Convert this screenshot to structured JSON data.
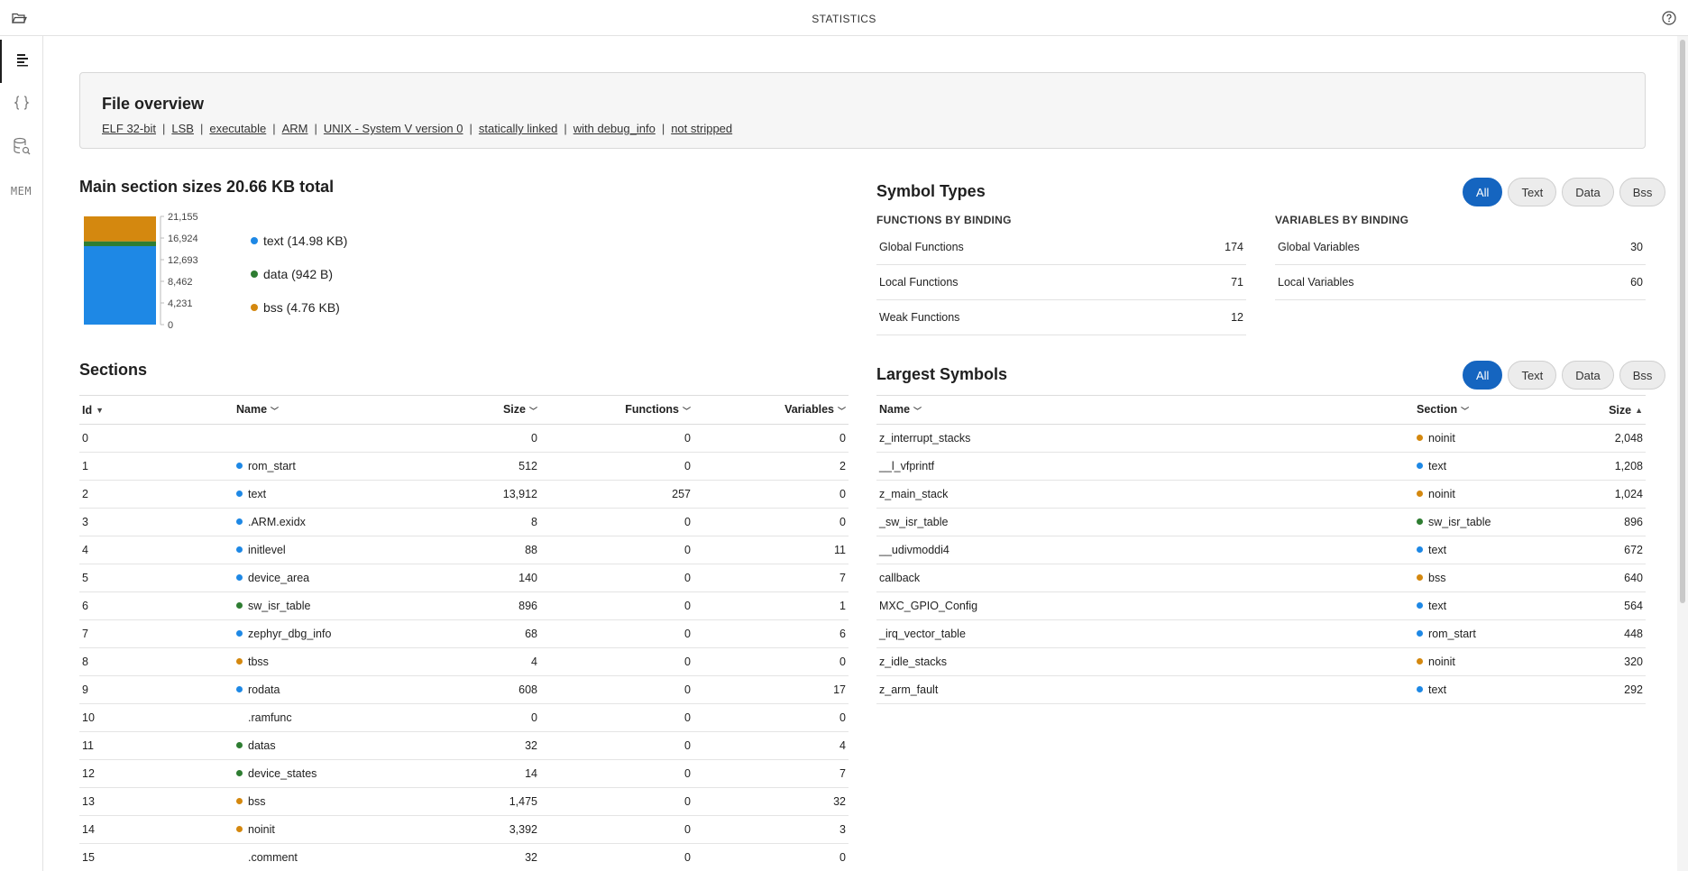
{
  "app": {
    "title": "STATISTICS"
  },
  "overview": {
    "title": "File overview",
    "properties": [
      "ELF 32-bit",
      "LSB",
      "executable",
      "ARM",
      "UNIX - System V version 0",
      "statically linked",
      "with debug_info",
      "not stripped"
    ]
  },
  "sizes": {
    "title": "Main section sizes 20.66 KB total",
    "legend": [
      {
        "label": "text (14.98 KB)",
        "color": "#1e88e5"
      },
      {
        "label": "data (942 B)",
        "color": "#2e7d32"
      },
      {
        "label": "bss (4.76 KB)",
        "color": "#d4880f"
      }
    ]
  },
  "chart_data": {
    "type": "bar",
    "stacked": true,
    "categories": [
      ""
    ],
    "series": [
      {
        "name": "text",
        "values": [
          15340
        ],
        "color": "#1e88e5"
      },
      {
        "name": "data",
        "values": [
          942
        ],
        "color": "#2e7d32"
      },
      {
        "name": "bss",
        "values": [
          4873
        ],
        "color": "#d4880f"
      }
    ],
    "yticks": [
      "21,155",
      "16,924",
      "12,693",
      "8,462",
      "4,231",
      "0"
    ],
    "ylim": [
      0,
      21155
    ]
  },
  "symbol_types": {
    "title": "Symbol Types",
    "filters": [
      "All",
      "Text",
      "Data",
      "Bss"
    ],
    "active_filter": "All",
    "functions": {
      "title": "FUNCTIONS BY BINDING",
      "rows": [
        {
          "label": "Global Functions",
          "value": "174"
        },
        {
          "label": "Local Functions",
          "value": "71"
        },
        {
          "label": "Weak Functions",
          "value": "12"
        }
      ]
    },
    "variables": {
      "title": "VARIABLES BY BINDING",
      "rows": [
        {
          "label": "Global Variables",
          "value": "30"
        },
        {
          "label": "Local Variables",
          "value": "60"
        }
      ]
    }
  },
  "sections": {
    "title": "Sections",
    "columns": [
      "Id",
      "Name",
      "Size",
      "Functions",
      "Variables"
    ],
    "rows": [
      {
        "id": "0",
        "name": "",
        "color": "",
        "size": "0",
        "functions": "0",
        "variables": "0"
      },
      {
        "id": "1",
        "name": "rom_start",
        "color": "#1e88e5",
        "size": "512",
        "functions": "0",
        "variables": "2"
      },
      {
        "id": "2",
        "name": "text",
        "color": "#1e88e5",
        "size": "13,912",
        "functions": "257",
        "variables": "0"
      },
      {
        "id": "3",
        "name": ".ARM.exidx",
        "color": "#1e88e5",
        "size": "8",
        "functions": "0",
        "variables": "0"
      },
      {
        "id": "4",
        "name": "initlevel",
        "color": "#1e88e5",
        "size": "88",
        "functions": "0",
        "variables": "11"
      },
      {
        "id": "5",
        "name": "device_area",
        "color": "#1e88e5",
        "size": "140",
        "functions": "0",
        "variables": "7"
      },
      {
        "id": "6",
        "name": "sw_isr_table",
        "color": "#2e7d32",
        "size": "896",
        "functions": "0",
        "variables": "1"
      },
      {
        "id": "7",
        "name": "zephyr_dbg_info",
        "color": "#1e88e5",
        "size": "68",
        "functions": "0",
        "variables": "6"
      },
      {
        "id": "8",
        "name": "tbss",
        "color": "#d4880f",
        "size": "4",
        "functions": "0",
        "variables": "0"
      },
      {
        "id": "9",
        "name": "rodata",
        "color": "#1e88e5",
        "size": "608",
        "functions": "0",
        "variables": "17"
      },
      {
        "id": "10",
        "name": ".ramfunc",
        "color": "",
        "size": "0",
        "functions": "0",
        "variables": "0"
      },
      {
        "id": "11",
        "name": "datas",
        "color": "#2e7d32",
        "size": "32",
        "functions": "0",
        "variables": "4"
      },
      {
        "id": "12",
        "name": "device_states",
        "color": "#2e7d32",
        "size": "14",
        "functions": "0",
        "variables": "7"
      },
      {
        "id": "13",
        "name": "bss",
        "color": "#d4880f",
        "size": "1,475",
        "functions": "0",
        "variables": "32"
      },
      {
        "id": "14",
        "name": "noinit",
        "color": "#d4880f",
        "size": "3,392",
        "functions": "0",
        "variables": "3"
      },
      {
        "id": "15",
        "name": ".comment",
        "color": "",
        "size": "32",
        "functions": "0",
        "variables": "0"
      }
    ]
  },
  "largest": {
    "title": "Largest Symbols",
    "filters": [
      "All",
      "Text",
      "Data",
      "Bss"
    ],
    "active_filter": "All",
    "columns": [
      "Name",
      "Section",
      "Size"
    ],
    "rows": [
      {
        "name": "z_interrupt_stacks",
        "section": "noinit",
        "color": "#d4880f",
        "size": "2,048"
      },
      {
        "name": "__l_vfprintf",
        "section": "text",
        "color": "#1e88e5",
        "size": "1,208"
      },
      {
        "name": "z_main_stack",
        "section": "noinit",
        "color": "#d4880f",
        "size": "1,024"
      },
      {
        "name": "_sw_isr_table",
        "section": "sw_isr_table",
        "color": "#2e7d32",
        "size": "896"
      },
      {
        "name": "__udivmoddi4",
        "section": "text",
        "color": "#1e88e5",
        "size": "672"
      },
      {
        "name": "callback",
        "section": "bss",
        "color": "#d4880f",
        "size": "640"
      },
      {
        "name": "MXC_GPIO_Config",
        "section": "text",
        "color": "#1e88e5",
        "size": "564"
      },
      {
        "name": "_irq_vector_table",
        "section": "rom_start",
        "color": "#1e88e5",
        "size": "448"
      },
      {
        "name": "z_idle_stacks",
        "section": "noinit",
        "color": "#d4880f",
        "size": "320"
      },
      {
        "name": "z_arm_fault",
        "section": "text",
        "color": "#1e88e5",
        "size": "292"
      }
    ]
  },
  "sidebar": {
    "items": [
      {
        "icon": "statistics-icon",
        "active": true
      },
      {
        "icon": "braces-icon",
        "active": false
      },
      {
        "icon": "database-search-icon",
        "active": false
      },
      {
        "icon": "mem-icon",
        "label": "MEM",
        "active": false
      }
    ]
  }
}
